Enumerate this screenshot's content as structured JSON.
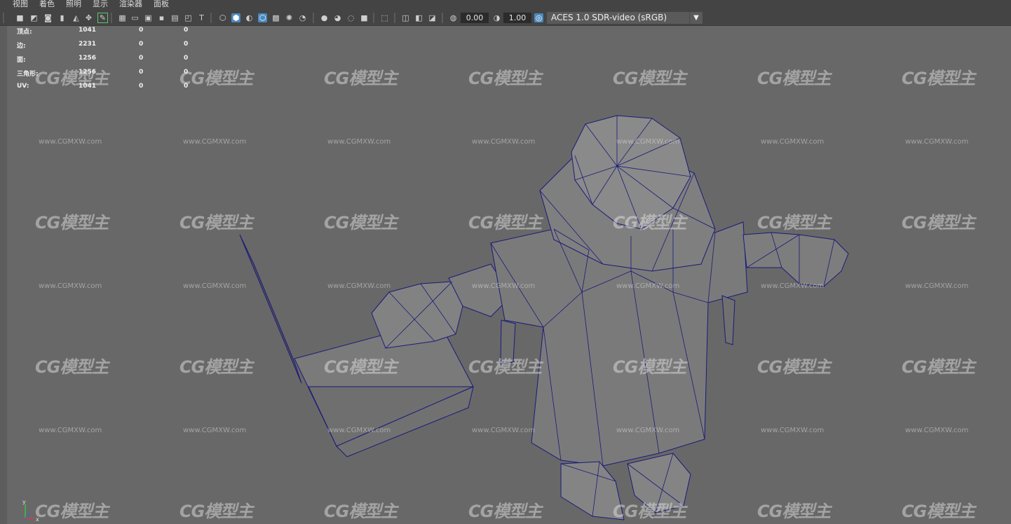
{
  "menu": [
    "视图",
    "着色",
    "照明",
    "显示",
    "渲染器",
    "面板"
  ],
  "toolbar": {
    "field1": "0.00",
    "field2": "1.00",
    "colorspace": "ACES 1.0 SDR-video (sRGB)"
  },
  "hud": [
    {
      "label": "顶点:",
      "total": "1041",
      "selected": "0",
      "last": "0"
    },
    {
      "label": "边:",
      "total": "2231",
      "selected": "0",
      "last": "0"
    },
    {
      "label": "面:",
      "total": "1256",
      "selected": "0",
      "last": "0"
    },
    {
      "label": "三角形:",
      "total": "1256",
      "selected": "0",
      "last": "0"
    },
    {
      "label": "UV:",
      "total": "1041",
      "selected": "0",
      "last": "0"
    }
  ],
  "watermark": {
    "logo": "CG模型主",
    "url": "www.CGMXW.com"
  },
  "axis": {
    "y_label": "y",
    "x_label": "x"
  }
}
